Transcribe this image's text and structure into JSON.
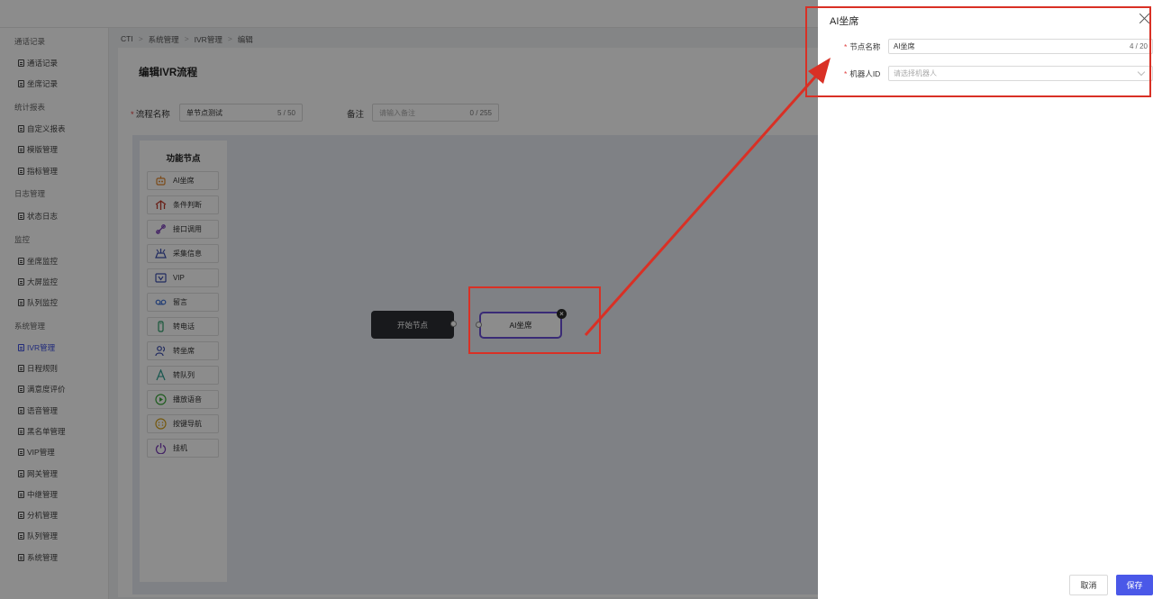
{
  "sidebar": {
    "groups": [
      {
        "label": "通话记录",
        "items": [
          "通话记录",
          "坐席记录"
        ]
      },
      {
        "label": "统计报表",
        "items": [
          "自定义报表",
          "模版管理",
          "指标管理"
        ]
      },
      {
        "label": "日志管理",
        "items": [
          "状态日志"
        ]
      },
      {
        "label": "监控",
        "items": [
          "坐席监控",
          "大屏监控",
          "队列监控"
        ]
      },
      {
        "label": "系统管理",
        "items": [
          "IVR管理",
          "日程规则",
          "满意度评价",
          "语音管理",
          "黑名单管理",
          "VIP管理",
          "网关管理",
          "中继管理",
          "分机管理",
          "队列管理",
          "系统管理"
        ]
      }
    ],
    "active_item": "IVR管理"
  },
  "breadcrumb": [
    "CTI",
    "系统管理",
    "IVR管理",
    "编辑"
  ],
  "page": {
    "title": "编辑IVR流程",
    "flow_name_label": "流程名称",
    "flow_name_value": "单节点测试",
    "flow_name_count": "5 / 50",
    "remark_label": "备注",
    "remark_placeholder": "请输入备注",
    "remark_count": "0 / 255"
  },
  "palette": {
    "title": "功能节点",
    "items": [
      {
        "label": "AI坐席",
        "icon": "robot-icon",
        "color": "#e0862a"
      },
      {
        "label": "条件判断",
        "icon": "branch-icon",
        "color": "#c0392b"
      },
      {
        "label": "接口调用",
        "icon": "api-link-icon",
        "color": "#7b3fb8"
      },
      {
        "label": "采集信息",
        "icon": "collect-icon",
        "color": "#3c4fb0"
      },
      {
        "label": "VIP",
        "icon": "vip-icon",
        "color": "#3c4fb0"
      },
      {
        "label": "留言",
        "icon": "voicemail-icon",
        "color": "#3d6fd6"
      },
      {
        "label": "转电话",
        "icon": "phone-transfer-icon",
        "color": "#2a9d6a"
      },
      {
        "label": "转坐席",
        "icon": "agent-transfer-icon",
        "color": "#3c4fb0"
      },
      {
        "label": "转队列",
        "icon": "queue-transfer-icon",
        "color": "#2a9d8f"
      },
      {
        "label": "播放语音",
        "icon": "play-icon",
        "color": "#3aa83a"
      },
      {
        "label": "按键导航",
        "icon": "keypad-icon",
        "color": "#d7a21a"
      },
      {
        "label": "挂机",
        "icon": "power-icon",
        "color": "#7b3fb8"
      }
    ]
  },
  "flow": {
    "start_node_label": "开始节点",
    "ai_node_label": "AI坐席"
  },
  "drawer": {
    "title": "AI坐席",
    "node_name_label": "节点名称",
    "node_name_value": "AI坐席",
    "node_name_count": "4 / 20",
    "robot_id_label": "机器人ID",
    "robot_id_placeholder": "请选择机器人",
    "cancel_label": "取消",
    "save_label": "保存"
  },
  "colors": {
    "accent": "#4a58e8",
    "node_border": "#6b4fd8",
    "annotation": "#d93025"
  }
}
